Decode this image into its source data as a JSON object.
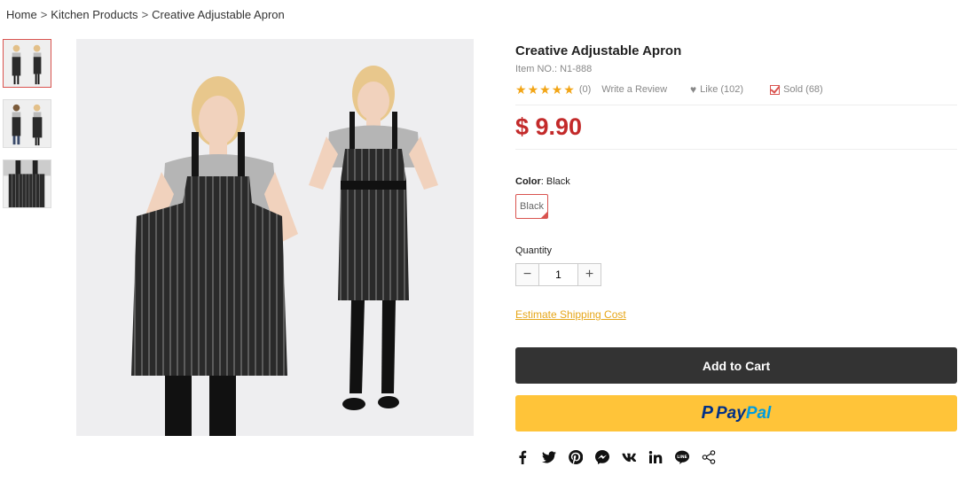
{
  "breadcrumb": {
    "items": [
      "Home",
      "Kitchen Products",
      "Creative Adjustable Apron"
    ],
    "separator": ">"
  },
  "product": {
    "title": "Creative Adjustable Apron",
    "item_no": "Item NO.: N1-888",
    "rating_stars": 5,
    "review_count": "(0)",
    "write_review": "Write a Review",
    "like": "Like (102)",
    "sold": "Sold (68)",
    "price": "$ 9.90",
    "price_color": "#c32a2a"
  },
  "color": {
    "label": "Color",
    "selected": "Black",
    "options": [
      "Black"
    ]
  },
  "quantity": {
    "label": "Quantity",
    "value": "1",
    "minus": "−",
    "plus": "+"
  },
  "shipping_link": "Estimate Shipping Cost",
  "buttons": {
    "add_to_cart": "Add to Cart",
    "paypal_pay": "Pay",
    "paypal_pal": "Pal"
  },
  "share_icons": [
    "facebook-icon",
    "twitter-icon",
    "pinterest-icon",
    "messenger-icon",
    "vk-icon",
    "linkedin-icon",
    "line-icon",
    "share-icon"
  ],
  "thumbnails": [
    "two-models-front",
    "two-models-back",
    "apron-closeup"
  ],
  "colors": {
    "accent": "#e6a619",
    "dark_button": "#333333",
    "paypal_bg": "#ffc439",
    "selected_border": "#d9534f"
  }
}
